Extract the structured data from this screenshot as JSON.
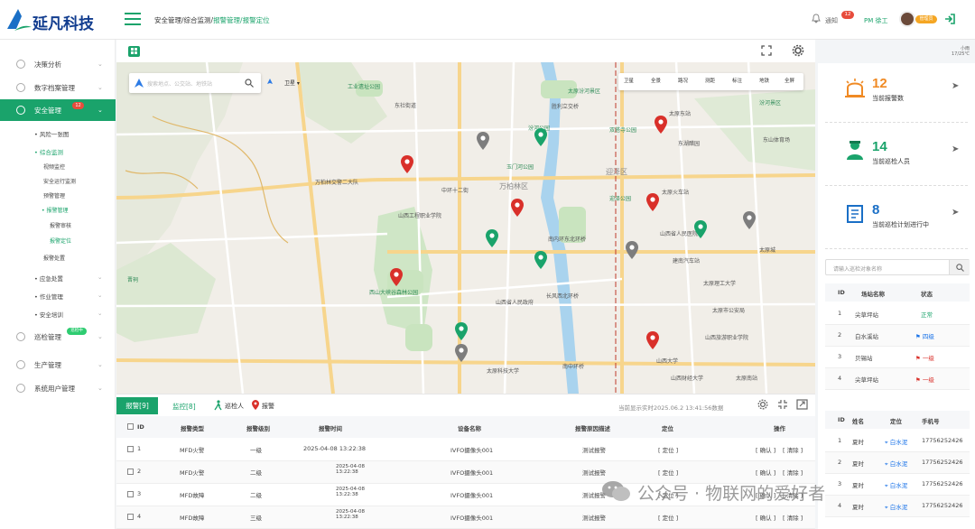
{
  "brand": {
    "name": "延凡科技"
  },
  "header": {
    "breadcrumb_main": "安全管理/综合监测/",
    "breadcrumb_active": "报警管理/报警定位",
    "notify_label": "通知",
    "notify_badge": "12",
    "user_label": "PM 徐工",
    "user_tag": "管理员"
  },
  "weather": {
    "line1": "小雨",
    "line2": "17/25℃"
  },
  "sidebar": {
    "items": [
      {
        "label": "决策分析"
      },
      {
        "label": "数字档案管理"
      },
      {
        "label": "安全管理",
        "badge": "12"
      },
      {
        "label": "巡检管理",
        "badge": "巡检中"
      },
      {
        "label": "生产管理"
      },
      {
        "label": "系统用户管理"
      }
    ],
    "sub": {
      "risk": "风险一张图",
      "monitor": "综合监测",
      "m1": "视频监控",
      "m2": "安全运行监测",
      "m3": "预警管理",
      "m4": "报警管理",
      "m4a": "报警审核",
      "m4b": "报警定位",
      "m5": "报警处置",
      "emergency": "应急处置",
      "work": "作业管理",
      "training": "安全培训"
    }
  },
  "map": {
    "search_placeholder": "搜索地点、公交站、地铁站",
    "layer_select": "卫星",
    "tools": [
      "卫星",
      "全景",
      "路况",
      "测距",
      "标注",
      "地铁",
      "全屏"
    ],
    "labels": {
      "l1": "工业遗址公园",
      "l2": "东社街道",
      "l3": "太原汾河景区",
      "l4": "胜利立交桥",
      "l5": "太原东站",
      "l6": "汾河公园",
      "l7": "双塔寺公园",
      "l8": "东湖醋园",
      "l9": "迎泽公园",
      "l10": "万柏林区",
      "l11": "中环十二街",
      "l12": "玉门河公园",
      "l13": "山西工程职业学院",
      "l14": "南内环东北环桥",
      "l15": "山西省人民医院",
      "l16": "建南汽车站",
      "l17": "西山大峡谷森林公园",
      "l18": "长风西北环桥",
      "l19": "山西大学",
      "l20": "太原理工大学",
      "l21": "南中环桥",
      "l22": "太原科技大学",
      "l23": "山西财经大学",
      "l24": "太原南站",
      "l25": "晋祠",
      "l26": "太原市公安局",
      "l27": "万柏林交警二大队",
      "l28": "迎泽区",
      "l29": "太原火车站",
      "l30": "山西省人民政府",
      "l31": "东山体育场",
      "l32": "汾河景区",
      "l33": "山西旅游职业学院",
      "l34": "太原城"
    }
  },
  "stats": [
    {
      "value": "12",
      "label": "当前报警数"
    },
    {
      "value": "14",
      "label": "当前巡检人员"
    },
    {
      "value": "8",
      "label": "当前巡检计划进行中"
    }
  ],
  "search_site": {
    "placeholder": "请输入巡检对象名称"
  },
  "site_table": {
    "headers": [
      "ID",
      "场站名称",
      "状态"
    ],
    "rows": [
      {
        "id": "1",
        "name": "尖草坪站",
        "status": "正常"
      },
      {
        "id": "2",
        "name": "白水溪站",
        "status": "四级"
      },
      {
        "id": "3",
        "name": "贝锡站",
        "status": "一级"
      },
      {
        "id": "4",
        "name": "尖草坪站",
        "status": "一级"
      }
    ]
  },
  "staff_table": {
    "headers": [
      "ID",
      "姓名",
      "定位",
      "手机号"
    ],
    "rows": [
      {
        "id": "1",
        "name": "夏时",
        "loc": "白水泥",
        "phone": "17756252426"
      },
      {
        "id": "2",
        "name": "夏时",
        "loc": "白水泥",
        "phone": "17756252426"
      },
      {
        "id": "3",
        "name": "夏时",
        "loc": "白水泥",
        "phone": "17756252426"
      },
      {
        "id": "4",
        "name": "夏时",
        "loc": "白水泥",
        "phone": "17756252426"
      }
    ]
  },
  "bottom": {
    "tab_alarm": "报警[9]",
    "tab_monitor": "监控[8]",
    "legend_patrol": "巡检人",
    "legend_alarm": "报警",
    "realtime": "当前显示实时2025.06.2  13:41:56数据",
    "headers": [
      "ID",
      "报警类型",
      "报警级别",
      "报警时间",
      "设备名称",
      "报警原因描述",
      "定位",
      "操作"
    ],
    "rows": [
      {
        "id": "1",
        "type": "MFD火警",
        "level": "一级",
        "time": "2025-04-08   13:22:38",
        "device": "IVFO摄像头001",
        "reason": "测试报警",
        "loc": "[ 定位 ]",
        "op1": "[ 确认 ]",
        "op2": "[ 清除 ]"
      },
      {
        "id": "2",
        "type": "MFD火警",
        "level": "二级",
        "time": "2025-04-08  13:22:38",
        "device": "IVFO摄像头001",
        "reason": "测试报警",
        "loc": "[ 定位 ]",
        "op1": "[ 确认 ]",
        "op2": "[ 清除 ]"
      },
      {
        "id": "3",
        "type": "MFD故障",
        "level": "二级",
        "time": "2025-04-08  13:22:38",
        "device": "IVFO摄像头001",
        "reason": "测试报警",
        "loc": "[ 定位 ]",
        "op1": "[ 确认 ]",
        "op2": "[ 清除 ]"
      },
      {
        "id": "4",
        "type": "MFD故障",
        "level": "三级",
        "time": "2025-04-08  13:22:38",
        "device": "IVFO摄像头001",
        "reason": "测试报警",
        "loc": "[ 定位 ]",
        "op1": "[ 确认 ]",
        "op2": "[ 清除 ]"
      }
    ]
  },
  "watermark": "公众号 · 物联网的爱好者",
  "colors": {
    "brand": "#1aa36b",
    "alarm": "#d9302a",
    "accent_blue": "#1a73e8",
    "warn_orange": "#f08a24"
  }
}
